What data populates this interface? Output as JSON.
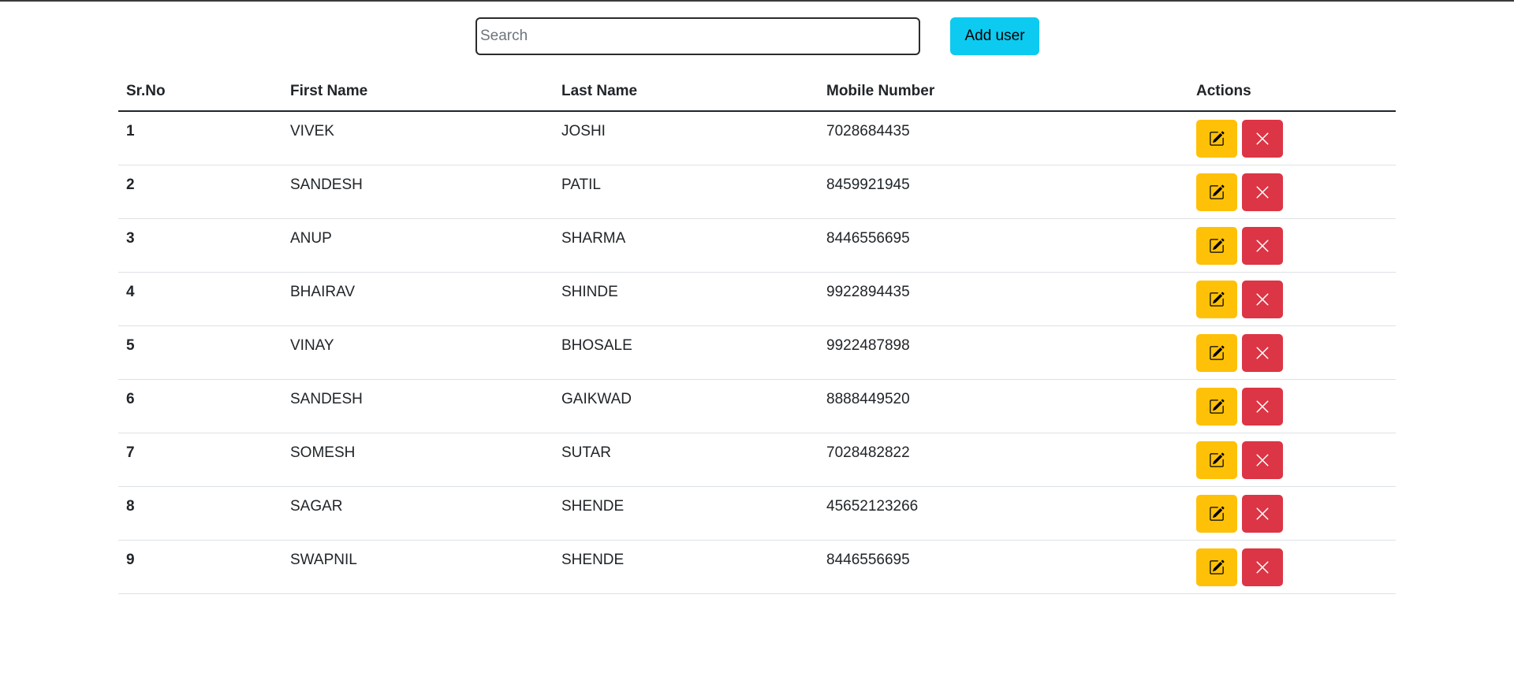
{
  "search": {
    "placeholder": "Search",
    "value": ""
  },
  "toolbar": {
    "add_label": "Add user"
  },
  "table": {
    "headers": {
      "sr": "Sr.No",
      "first": "First Name",
      "last": "Last Name",
      "mobile": "Mobile Number",
      "actions": "Actions"
    },
    "rows": [
      {
        "sr": "1",
        "first": "VIVEK",
        "last": "JOSHI",
        "mobile": "7028684435"
      },
      {
        "sr": "2",
        "first": "SANDESH",
        "last": "PATIL",
        "mobile": "8459921945"
      },
      {
        "sr": "3",
        "first": "ANUP",
        "last": "SHARMA",
        "mobile": "8446556695"
      },
      {
        "sr": "4",
        "first": "BHAIRAV",
        "last": "SHINDE",
        "mobile": "9922894435"
      },
      {
        "sr": "5",
        "first": "VINAY",
        "last": "BHOSALE",
        "mobile": "9922487898"
      },
      {
        "sr": "6",
        "first": "SANDESH",
        "last": "GAIKWAD",
        "mobile": "8888449520"
      },
      {
        "sr": "7",
        "first": "SOMESH",
        "last": "SUTAR",
        "mobile": "7028482822"
      },
      {
        "sr": "8",
        "first": "SAGAR",
        "last": "SHENDE",
        "mobile": "45652123266"
      },
      {
        "sr": "9",
        "first": "SWAPNIL",
        "last": "SHENDE",
        "mobile": "8446556695"
      }
    ]
  },
  "icons": {
    "edit": "pencil-square-icon",
    "delete": "close-icon"
  },
  "colors": {
    "add": "#0dcaf0",
    "edit": "#ffc107",
    "delete": "#dc3545"
  }
}
